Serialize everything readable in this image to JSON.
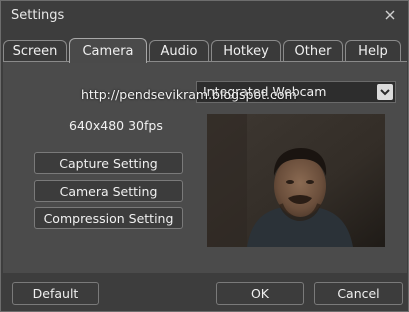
{
  "window": {
    "title": "Settings"
  },
  "tabs": [
    {
      "label": "Screen"
    },
    {
      "label": "Camera"
    },
    {
      "label": "Audio"
    },
    {
      "label": "Hotkey"
    },
    {
      "label": "Other"
    },
    {
      "label": "Help"
    }
  ],
  "active_tab": "Camera",
  "camera": {
    "device_selected": "Integrated Webcam",
    "resolution_text": "640x480 30fps",
    "buttons": {
      "capture": "Capture Setting",
      "camera": "Camera Setting",
      "compression": "Compression Setting"
    }
  },
  "watermark": "http://pendsevikram.blogspot.com",
  "footer": {
    "default": "Default",
    "ok": "OK",
    "cancel": "Cancel"
  },
  "icons": {
    "close": "close-icon",
    "dropdown": "chevron-down-icon"
  },
  "colors": {
    "window_bg": "#3d3d3d",
    "panel_bg": "#4b4b4b",
    "text": "#f0f0f0"
  }
}
